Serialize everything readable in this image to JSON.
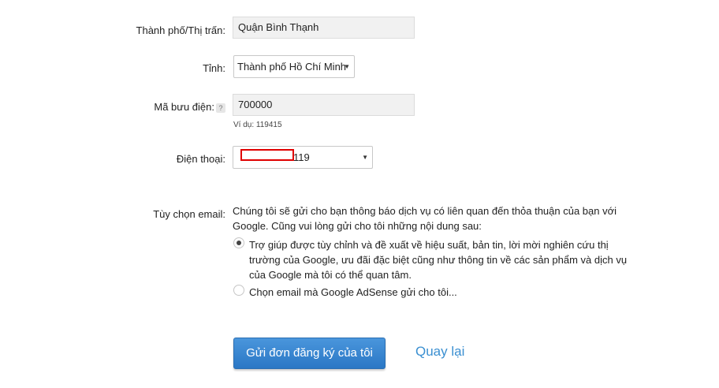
{
  "city": {
    "label": "Thành phố/Thị trấn:",
    "value": "Quận Bình Thạnh"
  },
  "province": {
    "label": "Tỉnh:",
    "selected": "Thành phố Hồ Chí Minh"
  },
  "postal_code": {
    "label": "Mã bưu điện:",
    "help_glyph": "?",
    "value": "700000",
    "hint": "Ví dụ: 119415"
  },
  "phone": {
    "label": "Điện thoại:",
    "value_suffix": "119"
  },
  "email_options": {
    "label": "Tùy chọn email:",
    "intro_line1": "Chúng tôi sẽ gửi cho bạn thông báo dịch vụ có liên quan đến thỏa thuận của bạn với",
    "intro_line2": "Google. Cũng vui lòng gửi cho tôi những nội dung sau:",
    "option1_line1": "Trợ giúp được tùy chỉnh và đề xuất về hiệu suất, bản tin, lời mời nghiên cứu thị",
    "option1_line2": "trường của Google, ưu đãi đặc biệt cũng như thông tin về các sản phẩm và dịch vụ",
    "option1_line3": "của Google mà tôi có thể quan tâm.",
    "option2": "Chọn email mà Google AdSense gửi cho tôi..."
  },
  "actions": {
    "submit": "Gửi đơn đăng ký của tôi",
    "back": "Quay lại"
  },
  "colors": {
    "primary_button": "#3183d2",
    "link": "#3a8fd1",
    "redaction": "#e00000"
  }
}
